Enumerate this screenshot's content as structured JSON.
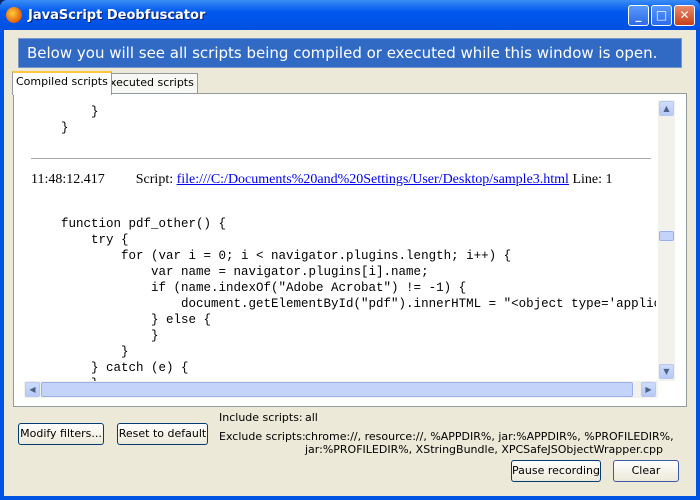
{
  "window": {
    "title": "JavaScript Deobfuscator"
  },
  "banner": "Below you will see all scripts being compiled or executed while this window is open.",
  "tabs": [
    {
      "label": "Compiled scripts",
      "active": true
    },
    {
      "label": "Executed scripts",
      "active": false
    }
  ],
  "code_top": "        }\n    }",
  "entry": {
    "time": "11:48:12.417",
    "script_label": "Script:",
    "url": "file:///C:/Documents%20and%20Settings/User/Desktop/sample3.html",
    "line_label": "Line: 1"
  },
  "code_body": "    function pdf_other() {\n        try {\n            for (var i = 0; i < navigator.plugins.length; i++) {\n                var name = navigator.plugins[i].name;\n                if (name.indexOf(\"Adobe Acrobat\") != -1) {\n                    document.getElementById(\"pdf\").innerHTML = \"<object type='application/pdf'\n                } else {\n                }\n            }\n        } catch (e) {\n        }",
  "filters": {
    "include_label": "Include scripts:",
    "include_value": "all",
    "exclude_label": "Exclude scripts:",
    "exclude_line1": "chrome://, resource://, %APPDIR%, jar:%APPDIR%, %PROFILEDIR%,",
    "exclude_line2": "jar:%PROFILEDIR%, XStringBundle, XPCSafeJSObjectWrapper.cpp"
  },
  "buttons": {
    "modify": "Modify filters...",
    "reset": "Reset to default",
    "pause": "Pause recording",
    "clear": "Clear"
  }
}
